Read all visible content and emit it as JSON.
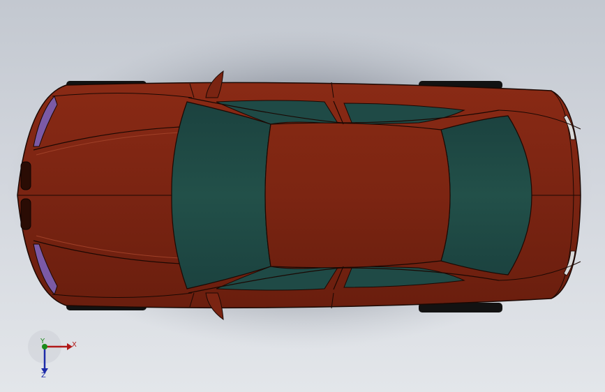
{
  "viewport": {
    "background_top": "#c3c8d0",
    "background_bottom": "#e3e6ea"
  },
  "model": {
    "subject": "sedan-car-top-view",
    "body_color": "#7a2412",
    "body_shade": "#5e1a0c",
    "glass_color": "#1f4a46",
    "headlight_color": "#7b5aa6",
    "edge_color": "#1a0803"
  },
  "triad": {
    "x_label": "X",
    "y_label": "Y",
    "z_label": "Z",
    "x_color": "#b01818",
    "y_color": "#1a8a1a",
    "z_color": "#1c2aa8"
  }
}
